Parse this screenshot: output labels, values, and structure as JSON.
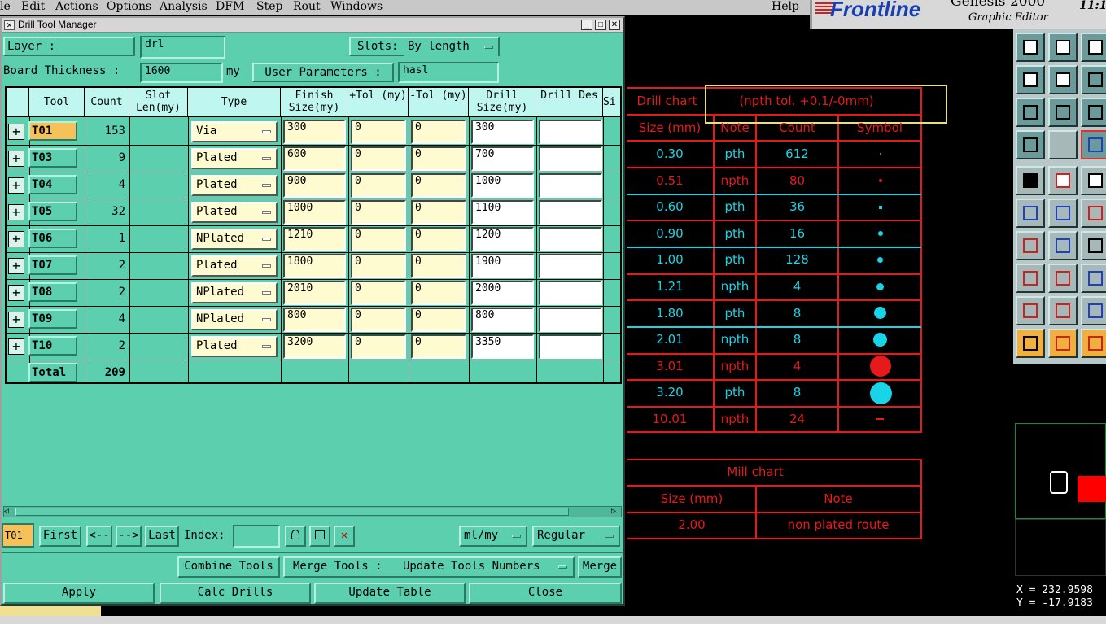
{
  "menubar": {
    "items": [
      "le",
      "Edit",
      "Actions",
      "Options",
      "Analysis",
      "DFM",
      "Step",
      "Rout",
      "Windows"
    ],
    "help": "Help"
  },
  "branding": {
    "logo": "Frontline",
    "product": "Genesis 2000",
    "subtitle": "Graphic Editor",
    "clock": "11:1"
  },
  "dialog": {
    "title": "Drill Tool Manager",
    "layer_label": "Layer :",
    "layer_value": "drl",
    "slots_label": "Slots:",
    "slots_value": "By length",
    "thickness_label": "Board Thickness :",
    "thickness_value": "1600",
    "thickness_unit": "my",
    "user_params_label": "User Parameters :",
    "user_params_value": "hasl",
    "columns": [
      "Tool",
      "Count",
      "Slot Len(my)",
      "Type",
      "Finish Size(my)",
      "+Tol (my)",
      "-Tol (my)",
      "Drill Size(my)",
      "Drill Des",
      "Si"
    ],
    "rows": [
      {
        "tool": "T01",
        "count": "153",
        "type": "Via",
        "finish": "300",
        "ptol": "0",
        "mtol": "0",
        "drill": "300",
        "des": ""
      },
      {
        "tool": "T03",
        "count": "9",
        "type": "Plated",
        "finish": "600",
        "ptol": "0",
        "mtol": "0",
        "drill": "700",
        "des": ""
      },
      {
        "tool": "T04",
        "count": "4",
        "type": "Plated",
        "finish": "900",
        "ptol": "0",
        "mtol": "0",
        "drill": "1000",
        "des": ""
      },
      {
        "tool": "T05",
        "count": "32",
        "type": "Plated",
        "finish": "1000",
        "ptol": "0",
        "mtol": "0",
        "drill": "1100",
        "des": ""
      },
      {
        "tool": "T06",
        "count": "1",
        "type": "NPlated",
        "finish": "1210",
        "ptol": "0",
        "mtol": "0",
        "drill": "1200",
        "des": ""
      },
      {
        "tool": "T07",
        "count": "2",
        "type": "Plated",
        "finish": "1800",
        "ptol": "0",
        "mtol": "0",
        "drill": "1900",
        "des": ""
      },
      {
        "tool": "T08",
        "count": "2",
        "type": "NPlated",
        "finish": "2010",
        "ptol": "0",
        "mtol": "0",
        "drill": "2000",
        "des": ""
      },
      {
        "tool": "T09",
        "count": "4",
        "type": "NPlated",
        "finish": "800",
        "ptol": "0",
        "mtol": "0",
        "drill": "800",
        "des": ""
      },
      {
        "tool": "T10",
        "count": "2",
        "type": "Plated",
        "finish": "3200",
        "ptol": "0",
        "mtol": "0",
        "drill": "3350",
        "des": ""
      }
    ],
    "total_label": "Total",
    "total_count": "209",
    "current_tool": "T01",
    "nav": {
      "first": "First",
      "prev": "<--",
      "next": "-->",
      "last": "Last",
      "index_label": "Index:",
      "index_value": ""
    },
    "units": "ml/my",
    "mode": "Regular",
    "combine_tools": "Combine Tools",
    "merge_tools_label": "Merge Tools :",
    "merge_option": "Update Tools Numbers",
    "merge": "Merge",
    "apply": "Apply",
    "calc_drills": "Calc Drills",
    "update_table": "Update Table",
    "close": "Close"
  },
  "drill_chart": {
    "title": "Drill chart",
    "tolerance": "(npth tol. +0.1/-0mm)",
    "headers": [
      "Size (mm)",
      "Note",
      "Count",
      "Symbol"
    ],
    "rows": [
      {
        "size": "0.30",
        "note": "pth",
        "count": "612",
        "color": "cyan"
      },
      {
        "size": "0.51",
        "note": "npth",
        "count": "80",
        "color": "red"
      },
      {
        "size": "0.60",
        "note": "pth",
        "count": "36",
        "color": "cyan"
      },
      {
        "size": "0.90",
        "note": "pth",
        "count": "16",
        "color": "cyan"
      },
      {
        "size": "1.00",
        "note": "pth",
        "count": "128",
        "color": "cyan"
      },
      {
        "size": "1.21",
        "note": "npth",
        "count": "4",
        "color": "cyan"
      },
      {
        "size": "1.80",
        "note": "pth",
        "count": "8",
        "color": "cyan"
      },
      {
        "size": "2.01",
        "note": "npth",
        "count": "8",
        "color": "cyan"
      },
      {
        "size": "3.01",
        "note": "npth",
        "count": "4",
        "color": "red"
      },
      {
        "size": "3.20",
        "note": "pth",
        "count": "8",
        "color": "cyan"
      },
      {
        "size": "10.01",
        "note": "npth",
        "count": "24",
        "color": "red"
      }
    ]
  },
  "mill_chart": {
    "title": "Mill chart",
    "headers": [
      "Size (mm)",
      "Note"
    ],
    "rows": [
      {
        "size": "2.00",
        "note": "non plated route"
      }
    ]
  },
  "colors": {
    "dialog_bg": "#5ccfaf",
    "chart_red": "#e61a1a",
    "chart_cyan": "#19d4e6",
    "selected_tool": "#f7c15a"
  },
  "coords": {
    "x": "X = 232.9598",
    "y": "Y = -17.9183"
  }
}
